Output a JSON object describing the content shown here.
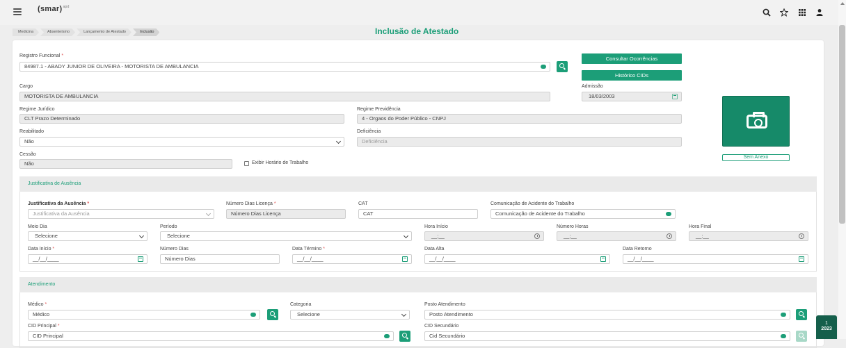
{
  "app": {
    "logo": "(smar)",
    "logo_sup": "apd"
  },
  "header_icons": [
    "search-icon",
    "star-icon",
    "apps-grid-icon",
    "user-icon"
  ],
  "breadcrumb": [
    "Medicina",
    "Absenteísmo",
    "Lançamento de Atestado",
    "Inclusão"
  ],
  "page_title": "Inclusão de Atestado",
  "top": {
    "registro_label": "Registro Funcional",
    "registro_value": "84987.1 - ABADY JUNIOR DE OLIVEIRA - MOTORISTA DE AMBULANCIA",
    "btn_consultar": "Consultar Ocorrências",
    "btn_historico": "Histórico CIDs",
    "cargo_label": "Cargo",
    "cargo_value": "MOTORISTA DE AMBULANCIA",
    "admissao_label": "Admissão",
    "admissao_value": "18/03/2003",
    "regime_juridico_label": "Regime Jurídico",
    "regime_juridico_value": "CLT Prazo Determinado",
    "regime_prev_label": "Regime Previdência",
    "regime_prev_value": "4 - Orgaos do Poder Público - CNPJ",
    "reabilitado_label": "Reabilitado",
    "reabilitado_value": "Não",
    "deficiencia_label": "Deficiência",
    "deficiencia_value": "Deficiência",
    "cessao_label": "Cessão",
    "cessao_value": "Não",
    "exibir_horario": "Exibir Horário de Trabalho",
    "sem_anexo": "Sem Anexo"
  },
  "justificativa": {
    "section_title": "Justificativa de Ausência",
    "justificativa_label": "Justificativa da Ausência",
    "justificativa_placeholder": "Justificativa da Ausência",
    "num_dias_licenca_label": "Número Dias Licença",
    "num_dias_licenca_placeholder": "Número Dias Licença",
    "cat_label": "CAT",
    "cat_placeholder": "CAT",
    "comunicacao_label": "Comunicação de Acidente do Trabalho",
    "comunicacao_placeholder": "Comunicação de Acidente do Trabalho",
    "meio_dia_label": "Meio Dia",
    "meio_dia_value": "Selecione",
    "periodo_label": "Período",
    "periodo_value": "Selecione",
    "hora_inicio_label": "Hora Início",
    "hora_inicio_value": "__:__",
    "numero_horas_label": "Número Horas",
    "numero_horas_value": "__:__",
    "hora_final_label": "Hora Final",
    "hora_final_value": "__:__",
    "data_inicio_label": "Data Início",
    "data_inicio_value": "__/__/____",
    "numero_dias_label": "Número Dias",
    "numero_dias_placeholder": "Número Dias",
    "data_termino_label": "Data Término",
    "data_termino_value": "__/__/____",
    "data_alta_label": "Data Alta",
    "data_alta_value": "__/__/____",
    "data_retorno_label": "Data Retorno",
    "data_retorno_value": "__/__/____"
  },
  "atendimento": {
    "section_title": "Atendimento",
    "medico_label": "Médico",
    "medico_placeholder": "Médico",
    "categoria_label": "Categoria",
    "categoria_value": "Selecione",
    "posto_label": "Posto Atendimento",
    "posto_placeholder": "Posto Atendimento",
    "cid_principal_label": "CID Principal",
    "cid_principal_placeholder": "CID Principal",
    "cid_secundario_label": "CID Secundário",
    "cid_secundario_placeholder": "Cid Secundário"
  },
  "year_badge": {
    "top": "1",
    "bottom": "2023"
  },
  "colors": {
    "accent": "#1c9e78",
    "accent_dark": "#155f4b"
  }
}
